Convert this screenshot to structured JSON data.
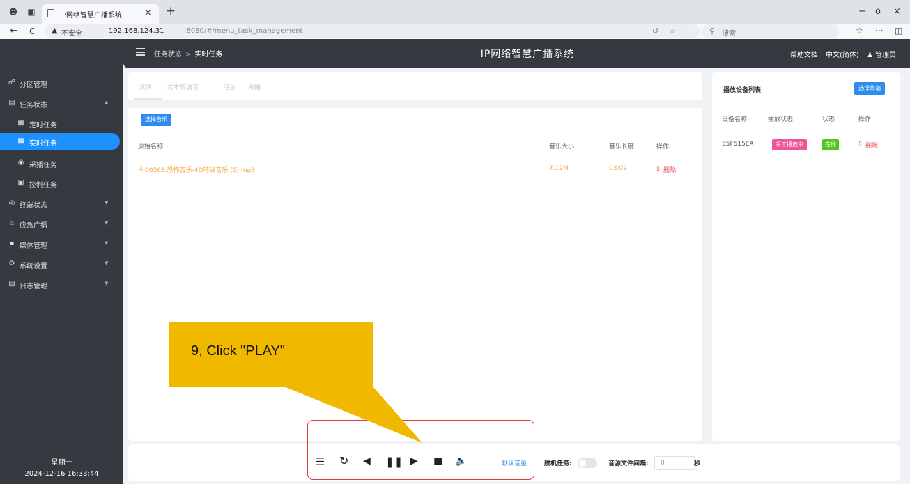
{
  "browser": {
    "tab_title": "IP网络智慧广播系统",
    "tab_close": "×",
    "new_tab": "+",
    "back": "←",
    "reload": "C",
    "not_secure": "不安全",
    "url_host": "192.168.124.31",
    "url_path": ":8080/#/menu_task_management",
    "search_placeholder": "搜索",
    "win_min": "−",
    "win_restore": "o",
    "win_close": "×",
    "more": "···"
  },
  "header": {
    "breadcrumb_parent": "任务状态",
    "breadcrumb_sep": ">",
    "breadcrumb_current": "实时任务",
    "title": "IP网络智慧广播系统",
    "help": "帮助文档",
    "language": "中文(简体)",
    "user": "管理员"
  },
  "sidebar": {
    "items": [
      {
        "label": "分区管理"
      },
      {
        "label": "任务状态"
      },
      {
        "label": "定时任务"
      },
      {
        "label": "实时任务"
      },
      {
        "label": "采播任务"
      },
      {
        "label": "控制任务"
      },
      {
        "label": "终端状态"
      },
      {
        "label": "应急广播"
      },
      {
        "label": "媒体管理"
      },
      {
        "label": "系统设置"
      },
      {
        "label": "日志管理"
      }
    ],
    "weekday": "星期一",
    "datetime": "2024-12-16 16:33:44"
  },
  "tabs": [
    {
      "label": "文件"
    },
    {
      "label": "文本转语音"
    },
    {
      "label": "电台"
    },
    {
      "label": "采播"
    }
  ],
  "music": {
    "select_button": "选择音乐",
    "columns": {
      "name": "原始名称",
      "size": "音乐大小",
      "length": "音乐长度",
      "action": "操作"
    },
    "rows": [
      {
        "name": "00563.恐怖音乐-4D环绕音乐 (5).mp3",
        "size": "7.12M",
        "length": "03:02",
        "action": "删除"
      }
    ]
  },
  "devices": {
    "title": "播放设备列表",
    "select_button": "选择终端",
    "columns": {
      "name": "设备名称",
      "play_status": "播放状态",
      "status": "状态",
      "action": "操作"
    },
    "rows": [
      {
        "name": "55F515EA",
        "play_status": "手工播放中",
        "status": "在线",
        "action": "删除"
      }
    ]
  },
  "controls": {
    "default_volume": "默认音量",
    "offline_task_label": "脱机任务:",
    "interval_label": "音源文件间隔:",
    "interval_value": "0",
    "interval_unit": "秒"
  },
  "annotation": {
    "text": "9, Click \"PLAY\""
  },
  "colors": {
    "sidebar_bg": "#343a40",
    "accent": "#1e90ff",
    "button_blue": "#2d8cf0",
    "play_status_badge": "#f0559a",
    "online_badge": "#52c41a",
    "delete_red": "#e64545",
    "file_orange": "#f5a54a",
    "callout_yellow": "#f1b800",
    "highlight_red": "#e03a3a"
  }
}
